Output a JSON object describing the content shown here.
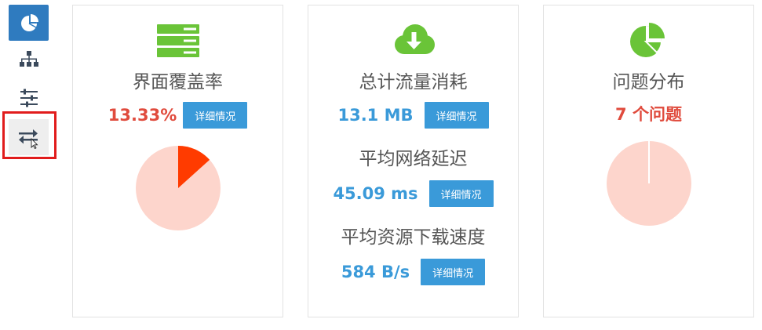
{
  "colors": {
    "accent_blue": "#3a9ad9",
    "sidebar_active": "#2f7bbf",
    "icon_green": "#6ac438",
    "value_red": "#e04b3d",
    "value_blue": "#3a9ad9",
    "pie_base": "#fdd5cc",
    "pie_slice": "#ff3b00",
    "highlight_red": "#e11c1c"
  },
  "sidebar": {
    "items": [
      {
        "icon": "pie-chart-icon",
        "active": true
      },
      {
        "icon": "sitemap-icon",
        "active": false
      },
      {
        "icon": "sliders-icon",
        "active": false
      },
      {
        "icon": "exchange-arrows-icon",
        "active": false,
        "hover": true
      }
    ]
  },
  "cards": {
    "coverage": {
      "icon": "server-stack-icon",
      "title": "界面覆盖率",
      "value": "13.33%",
      "button": "详细情况",
      "pie_fraction": 0.1333
    },
    "traffic": {
      "icon": "cloud-download-icon",
      "title": "总计流量消耗",
      "value": "13.1 MB",
      "button": "详细情况",
      "latency_title": "平均网络延迟",
      "latency_value": "45.09 ms",
      "latency_button": "详细情况",
      "speed_title": "平均资源下载速度",
      "speed_value": "584 B/s",
      "speed_button": "详细情况"
    },
    "issues": {
      "icon": "pie-chart-icon",
      "title": "问题分布",
      "value": "7 个问题"
    }
  }
}
